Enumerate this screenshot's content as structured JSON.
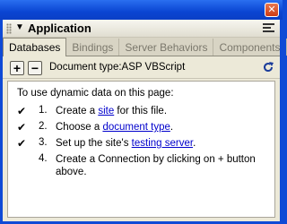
{
  "panel": {
    "title": "Application",
    "close_glyph": "✕"
  },
  "tabs": [
    {
      "label": "Databases",
      "active": true
    },
    {
      "label": "Bindings",
      "active": false
    },
    {
      "label": "Server Behaviors",
      "active": false
    },
    {
      "label": "Components",
      "active": false
    }
  ],
  "toolbar": {
    "add_glyph": "+",
    "remove_glyph": "−",
    "document_type": "Document type:ASP VBScript"
  },
  "content": {
    "intro": "To use dynamic data on this page:",
    "steps": [
      {
        "done": true,
        "number": "1.",
        "before": "Create a ",
        "link": "site",
        "after": " for this file."
      },
      {
        "done": true,
        "number": "2.",
        "before": "Choose a ",
        "link": "document type",
        "after": "."
      },
      {
        "done": true,
        "number": "3.",
        "before": "Set up the site's ",
        "link": "testing server",
        "after": "."
      },
      {
        "done": false,
        "number": "4.",
        "before": "Create a Connection by clicking on + button above.",
        "link": "",
        "after": ""
      }
    ],
    "check_glyph": "✔"
  },
  "colors": {
    "title_blue": "#0a45d2",
    "link": "#0000cc",
    "panel_bg": "#ece9d8"
  }
}
